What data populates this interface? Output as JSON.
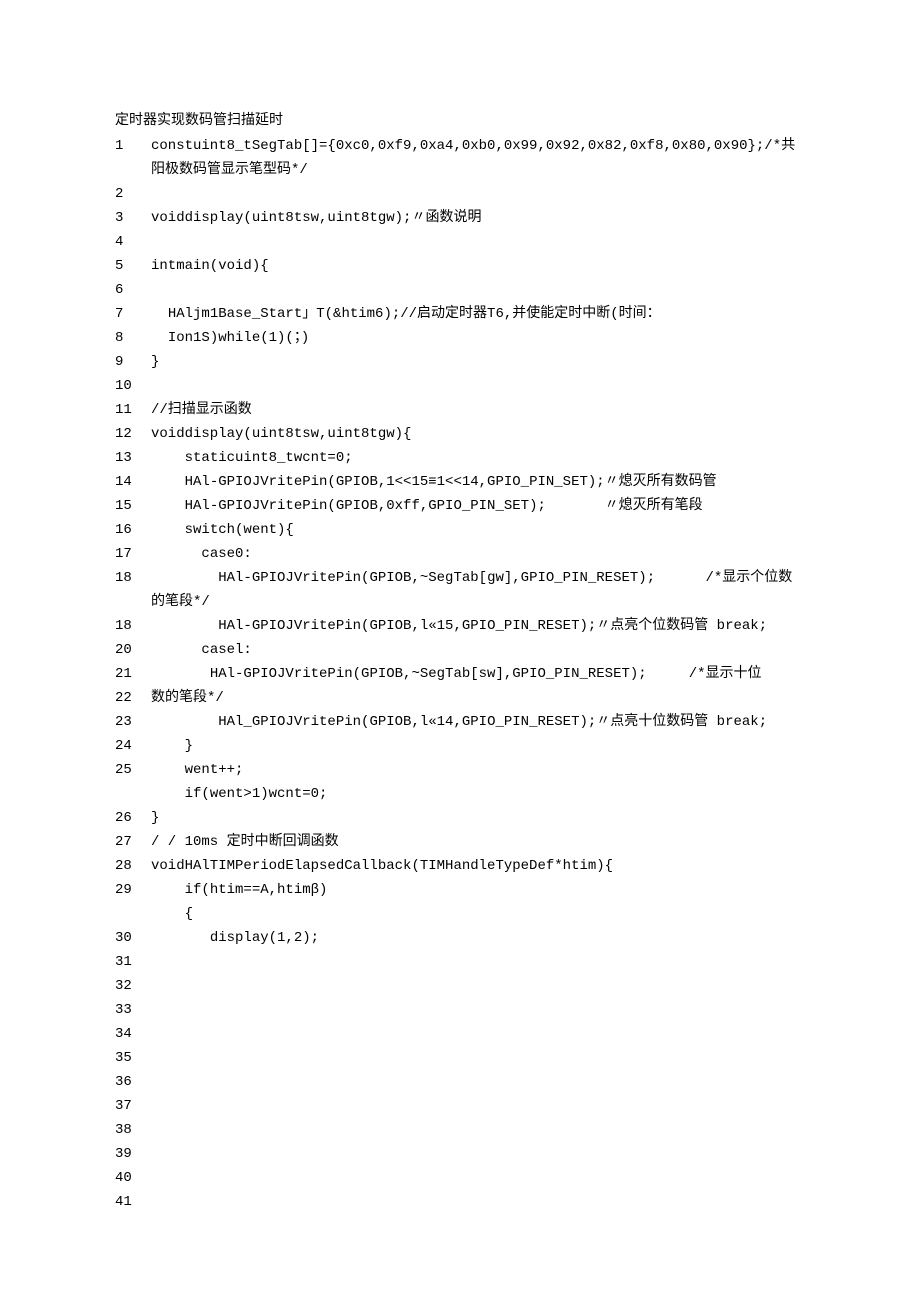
{
  "title": "定时器实现数码管扫描延时",
  "lines": [
    {
      "ln": "1",
      "c": "constuint8_tSegTab[]={0xc0,0xf9,0xa4,0xb0,0x99,0x92,0x82,0xf8,0x80,0x90};/*共阳极数码管显示笔型码*/"
    },
    {
      "ln": "2",
      "c": ""
    },
    {
      "ln": "3",
      "c": "voiddisplay(uint8tsw,uint8tgw);〃函数说明"
    },
    {
      "ln": "4",
      "c": ""
    },
    {
      "ln": "5",
      "c": "intmain(void){"
    },
    {
      "ln": "6",
      "c": ""
    },
    {
      "ln": "7",
      "c": "  HAljm1Base_Start」T(&htim6);//启动定时器T6,并使能定时中断(时间："
    },
    {
      "ln": "8",
      "c": "  Ion1S)while(1)(；)"
    },
    {
      "ln": "9",
      "c": "}"
    },
    {
      "ln": "10",
      "c": ""
    },
    {
      "ln": "11",
      "c": "//扫描显示函数"
    },
    {
      "ln": "12",
      "c": "voiddisplay(uint8tsw,uint8tgw){"
    },
    {
      "ln": "13",
      "c": "    staticuint8_twcnt=0;"
    },
    {
      "ln": "14",
      "c": "    HAl-GPIOJVritePin(GPIOB,1<<15≡1<<14,GPIO_PIN_SET);〃熄灭所有数码管"
    },
    {
      "ln": "15",
      "c": "    HAl-GPIOJVritePin(GPIOB,0xff,GPIO_PIN_SET);       〃熄灭所有笔段"
    },
    {
      "ln": "16",
      "c": "    switch(went){"
    },
    {
      "ln": "17",
      "c": "      case0:"
    },
    {
      "ln": "18",
      "c": "        HAl-GPIOJVritePin(GPIOB,~SegTab[gw],GPIO_PIN_RESET);      /*显示个位数的笔段*/"
    },
    {
      "ln": "18",
      "c": "        HAl-GPIOJVritePin(GPIOB,l«15,GPIO_PIN_RESET);〃点亮个位数码管 break;"
    },
    {
      "ln": "20",
      "c": "      casel:"
    },
    {
      "ln": "21",
      "c": "       HAl-GPIOJVritePin(GPIOB,~SegTab[sw],GPIO_PIN_RESET);     /*显示十位"
    },
    {
      "ln": "22",
      "c": "数的笔段*/"
    },
    {
      "ln": "23",
      "c": "        HAl_GPIOJVritePin(GPIOB,l«14,GPIO_PIN_RESET);〃点亮十位数码管 break;"
    },
    {
      "ln": "24",
      "c": "    }"
    },
    {
      "ln": "25",
      "c": "    went++;"
    },
    {
      "ln": "",
      "c": "    if(went>1)wcnt=0;"
    },
    {
      "ln": "26",
      "c": "}"
    },
    {
      "ln": "27",
      "c": "/ / 10ms 定时中断回调函数"
    },
    {
      "ln": "28",
      "c": "voidHAlTIMPeriodElapsedCallback(TIMHandleTypeDef*htim){"
    },
    {
      "ln": "29",
      "c": "    if(htim==A,htimβ)"
    },
    {
      "ln": "",
      "c": "    {"
    },
    {
      "ln": "30",
      "c": "       display(1,2);"
    },
    {
      "ln": "31",
      "c": ""
    },
    {
      "ln": "32",
      "c": ""
    },
    {
      "ln": "33",
      "c": ""
    },
    {
      "ln": "34",
      "c": ""
    },
    {
      "ln": "35",
      "c": ""
    },
    {
      "ln": "36",
      "c": ""
    },
    {
      "ln": "37",
      "c": ""
    },
    {
      "ln": "38",
      "c": ""
    },
    {
      "ln": "39",
      "c": ""
    },
    {
      "ln": "40",
      "c": ""
    },
    {
      "ln": "41",
      "c": ""
    }
  ]
}
